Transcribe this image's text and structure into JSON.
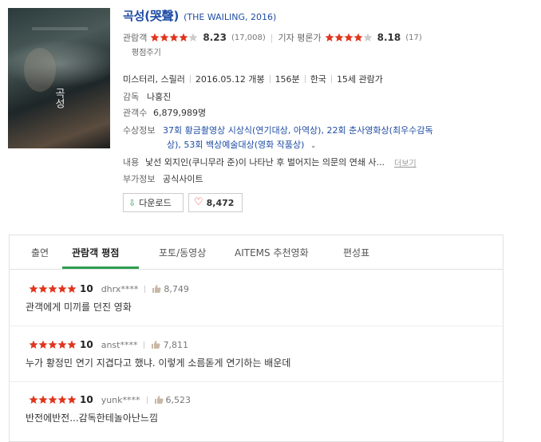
{
  "movie": {
    "title_kr": "곡성(哭聲)",
    "title_en": "(THE WAILING, 2016)",
    "poster_text": "곡성"
  },
  "ratings": {
    "audience_label": "관람객",
    "audience_score": "8.23",
    "audience_count": "(17,008)",
    "audience_stars_filled": 4,
    "critic_label": "기자 평론가",
    "critic_score": "8.18",
    "critic_count": "(17)",
    "critic_stars_filled": 4,
    "write_link": "평점주기"
  },
  "meta": {
    "genre": "미스터리, 스릴러",
    "release": "2016.05.12 개봉",
    "runtime": "156분",
    "country": "한국",
    "age": "15세 관람가"
  },
  "director": {
    "label": "감독",
    "value": "나홍진"
  },
  "audience": {
    "label": "관객수",
    "value": "6,879,989명"
  },
  "awards": {
    "label": "수상정보",
    "line1": "37회 황금촬영상 시상식(연기대상, 아역상), 22회 춘사영화상(최우수감독",
    "line2": "상), 53회 백상예술대상(영화 작품상)"
  },
  "content": {
    "label": "내용",
    "value": "낯선 외지인(쿠니무라 준)이 나타난 후 벌어지는 의문의 연쇄 사...",
    "more": "더보기"
  },
  "extra": {
    "label": "부가정보",
    "value": "공식사이트"
  },
  "buttons": {
    "download": "다운로드",
    "like_count": "8,472"
  },
  "tabs": [
    {
      "label": "출연"
    },
    {
      "label": "관람객 평점"
    },
    {
      "label": "포토/동영상"
    },
    {
      "label": "AITEMS 추천영화"
    },
    {
      "label": "편성표"
    }
  ],
  "reviews": [
    {
      "score": "10",
      "user": "dhrx****",
      "likes": "8,749",
      "text": "관객에게 미끼를 던진 영화"
    },
    {
      "score": "10",
      "user": "anst****",
      "likes": "7,811",
      "text": "누가 황정민 연기 지겹다고 했냐. 이렇게 소름돋게 연기하는 배운데"
    },
    {
      "score": "10",
      "user": "yunk****",
      "likes": "6,523",
      "text": "반전에반전...감독한테놀아난느낌"
    }
  ],
  "colors": {
    "star": "#e0351e",
    "star_empty": "#cccccc",
    "link": "#1f4da4",
    "tab_active": "#2e9e4f"
  }
}
